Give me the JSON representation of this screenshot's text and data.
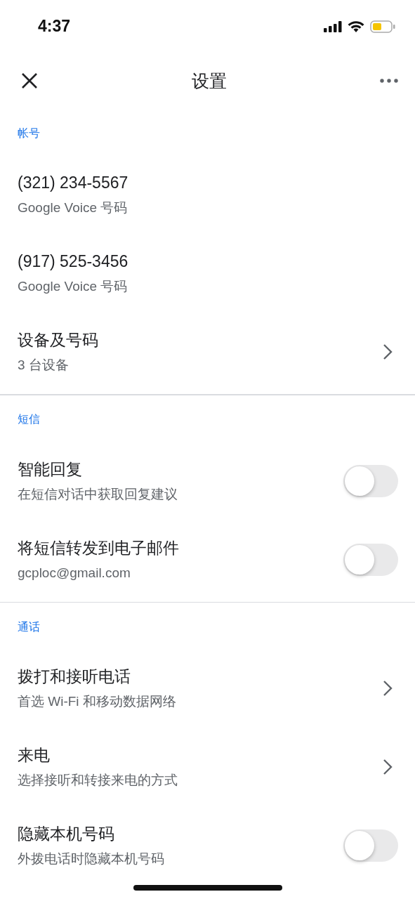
{
  "status_bar": {
    "time": "4:37"
  },
  "header": {
    "title": "设置"
  },
  "sections": [
    {
      "title": "帐号",
      "items": [
        {
          "kind": "plain",
          "title": "(321) 234-5567",
          "subtitle": "Google Voice 号码"
        },
        {
          "kind": "plain",
          "title": "(917) 525-3456",
          "subtitle": "Google Voice 号码"
        },
        {
          "kind": "link",
          "title": "设备及号码",
          "subtitle": "3 台设备"
        }
      ]
    },
    {
      "title": "短信",
      "items": [
        {
          "kind": "toggle",
          "title": "智能回复",
          "subtitle": "在短信对话中获取回复建议",
          "on": false
        },
        {
          "kind": "toggle",
          "title": "将短信转发到电子邮件",
          "subtitle": "gcploc@gmail.com",
          "on": false
        }
      ]
    },
    {
      "title": "通话",
      "items": [
        {
          "kind": "link",
          "title": "拨打和接听电话",
          "subtitle": "首选 Wi-Fi 和移动数据网络"
        },
        {
          "kind": "link",
          "title": "来电",
          "subtitle": "选择接听和转接来电的方式"
        },
        {
          "kind": "toggle",
          "title": "隐藏本机号码",
          "subtitle": "外拨电话时隐藏本机号码",
          "on": false
        }
      ]
    }
  ]
}
